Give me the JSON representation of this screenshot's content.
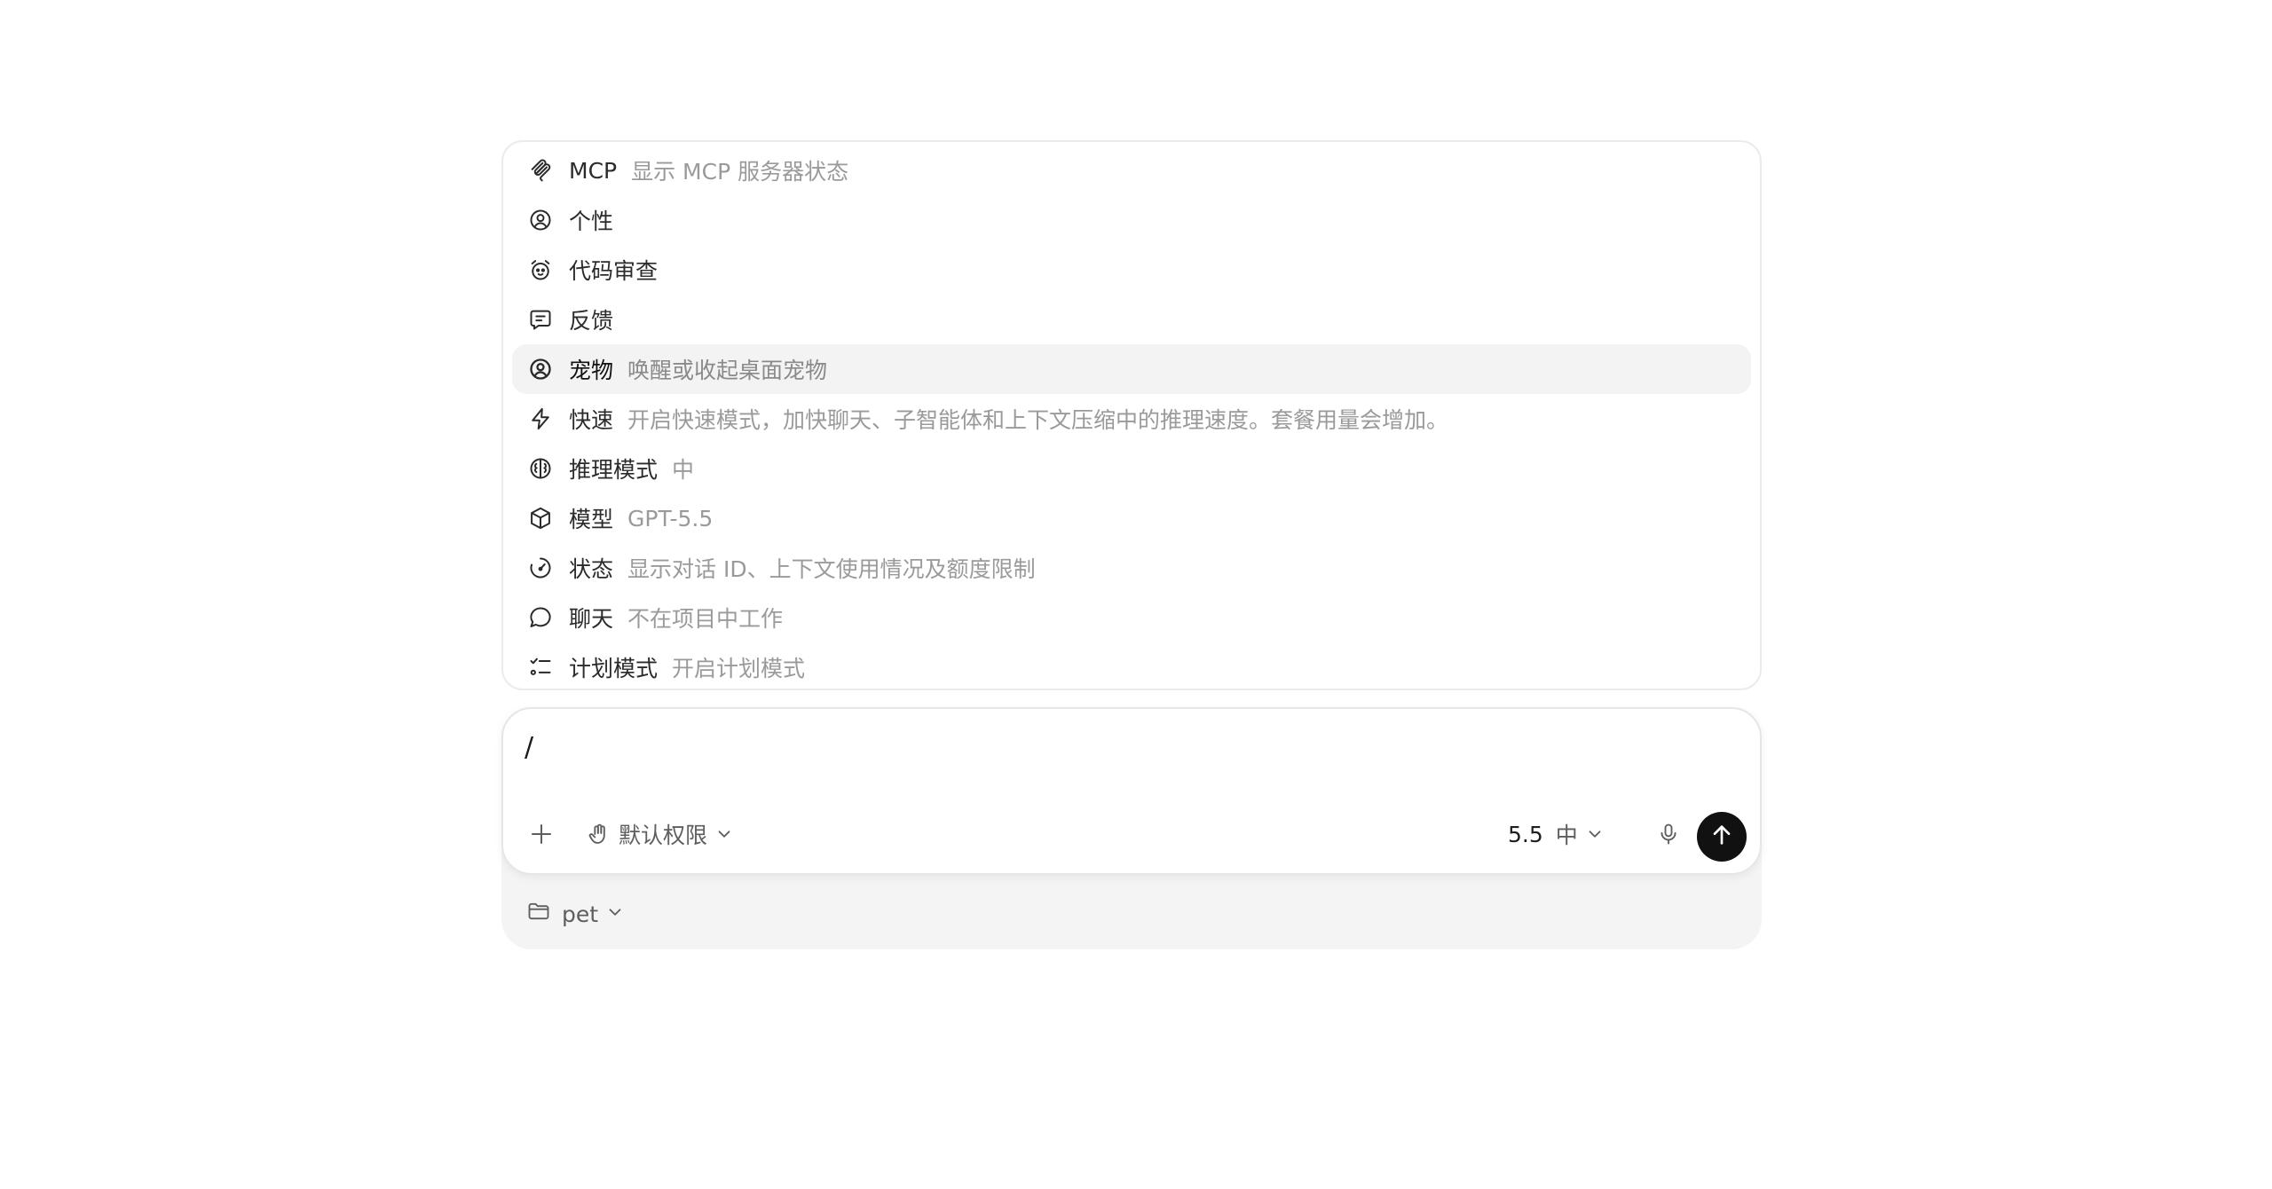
{
  "menu": {
    "items": [
      {
        "icon": "mcp-icon",
        "label": "MCP",
        "desc": "显示 MCP 服务器状态"
      },
      {
        "icon": "personality-icon",
        "label": "个性",
        "desc": ""
      },
      {
        "icon": "code-review-icon",
        "label": "代码审查",
        "desc": ""
      },
      {
        "icon": "feedback-icon",
        "label": "反馈",
        "desc": ""
      },
      {
        "icon": "pet-icon",
        "label": "宠物",
        "desc": "唤醒或收起桌面宠物"
      },
      {
        "icon": "lightning-icon",
        "label": "快速",
        "desc": "开启快速模式，加快聊天、子智能体和上下文压缩中的推理速度。套餐用量会增加。"
      },
      {
        "icon": "brain-icon",
        "label": "推理模式",
        "desc": "中"
      },
      {
        "icon": "cube-icon",
        "label": "模型",
        "desc": "GPT-5.5"
      },
      {
        "icon": "gauge-icon",
        "label": "状态",
        "desc": "显示对话 ID、上下文使用情况及额度限制"
      },
      {
        "icon": "chat-bubble-icon",
        "label": "聊天",
        "desc": "不在项目中工作"
      },
      {
        "icon": "checklist-icon",
        "label": "计划模式",
        "desc": "开启计划模式"
      }
    ]
  },
  "composer": {
    "input_value": "/",
    "permissions_label": "默认权限",
    "model_version": "5.5",
    "reasoning_level": "中"
  },
  "project": {
    "folder_label": "pet"
  }
}
